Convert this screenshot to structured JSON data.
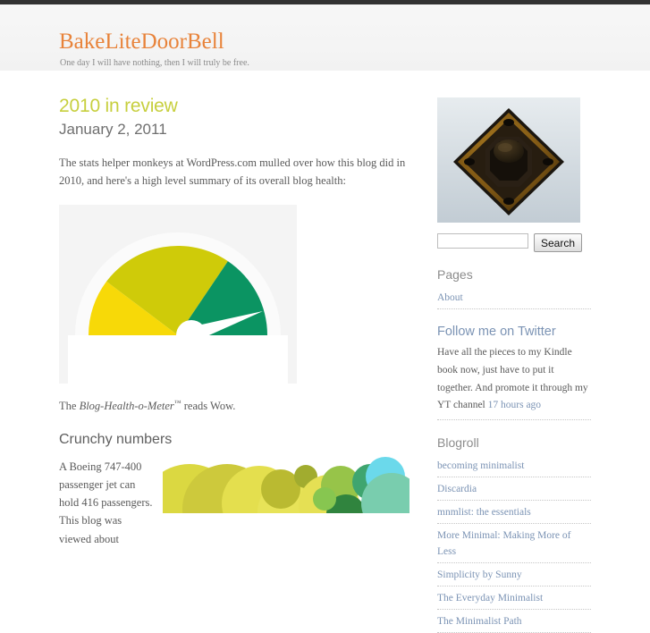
{
  "site": {
    "title": "BakeLiteDoorBell",
    "tagline": "One day I will have nothing, then I will truly be free."
  },
  "post": {
    "title": "2010 in review",
    "date": "January 2, 2011",
    "intro": "The stats helper monkeys at WordPress.com mulled over how this blog did in 2010, and here's a high level summary of its overall blog health:",
    "meter_prefix": "The ",
    "meter_name": "Blog-Health-o-Meter",
    "meter_tm": "™",
    "meter_suffix": " reads Wow.",
    "section_heading": "Crunchy numbers",
    "crunchy_text": "A Boeing 747-400 passenger jet can hold 416 passengers. This blog was viewed about"
  },
  "gauge": {
    "zones": [
      {
        "name": "low",
        "color": "#f7d908",
        "start_deg": 180,
        "end_deg": 143
      },
      {
        "name": "mid",
        "color": "#cfcb09",
        "start_deg": 143,
        "end_deg": 56
      },
      {
        "name": "high",
        "color": "#0b9462",
        "start_deg": 56,
        "end_deg": 0
      }
    ],
    "needle_color": "#ffffff",
    "needle_deg": 14,
    "panel_color": "#f4f4f4"
  },
  "crunchy_art": {
    "colors": [
      "#d8d531",
      "#e2dd3f",
      "#c9c52c",
      "#b5b520",
      "#8fbf3a",
      "#7dc242",
      "#1f7a2e",
      "#2f9e63",
      "#6ec9a8",
      "#5fd6ea",
      "#a6e0f5"
    ]
  },
  "sidebar": {
    "photo_alt": "bakelite doorbell",
    "search": {
      "value": "",
      "placeholder": "",
      "button_label": "Search"
    },
    "pages": {
      "heading": "Pages",
      "items": [
        {
          "label": "About"
        }
      ]
    },
    "twitter": {
      "heading": "Follow me on Twitter",
      "text": "Have all the pieces to my Kindle book now, just have to put it together. And promote it through my YT channel ",
      "time_link": "17 hours ago"
    },
    "blogroll": {
      "heading": "Blogroll",
      "items": [
        {
          "label": "becoming minimalist"
        },
        {
          "label": "Discardia"
        },
        {
          "label": "mnmlist: the essentials"
        },
        {
          "label": "More Minimal: Making More of Less"
        },
        {
          "label": "Simplicity by Sunny"
        },
        {
          "label": "The Everyday Minimalist"
        },
        {
          "label": "The Minimalist Path"
        }
      ]
    }
  },
  "colors": {
    "accent": "#e8833a",
    "post_title": "#c7cf3e",
    "link": "#7b93b4",
    "topbar": "#333333"
  }
}
